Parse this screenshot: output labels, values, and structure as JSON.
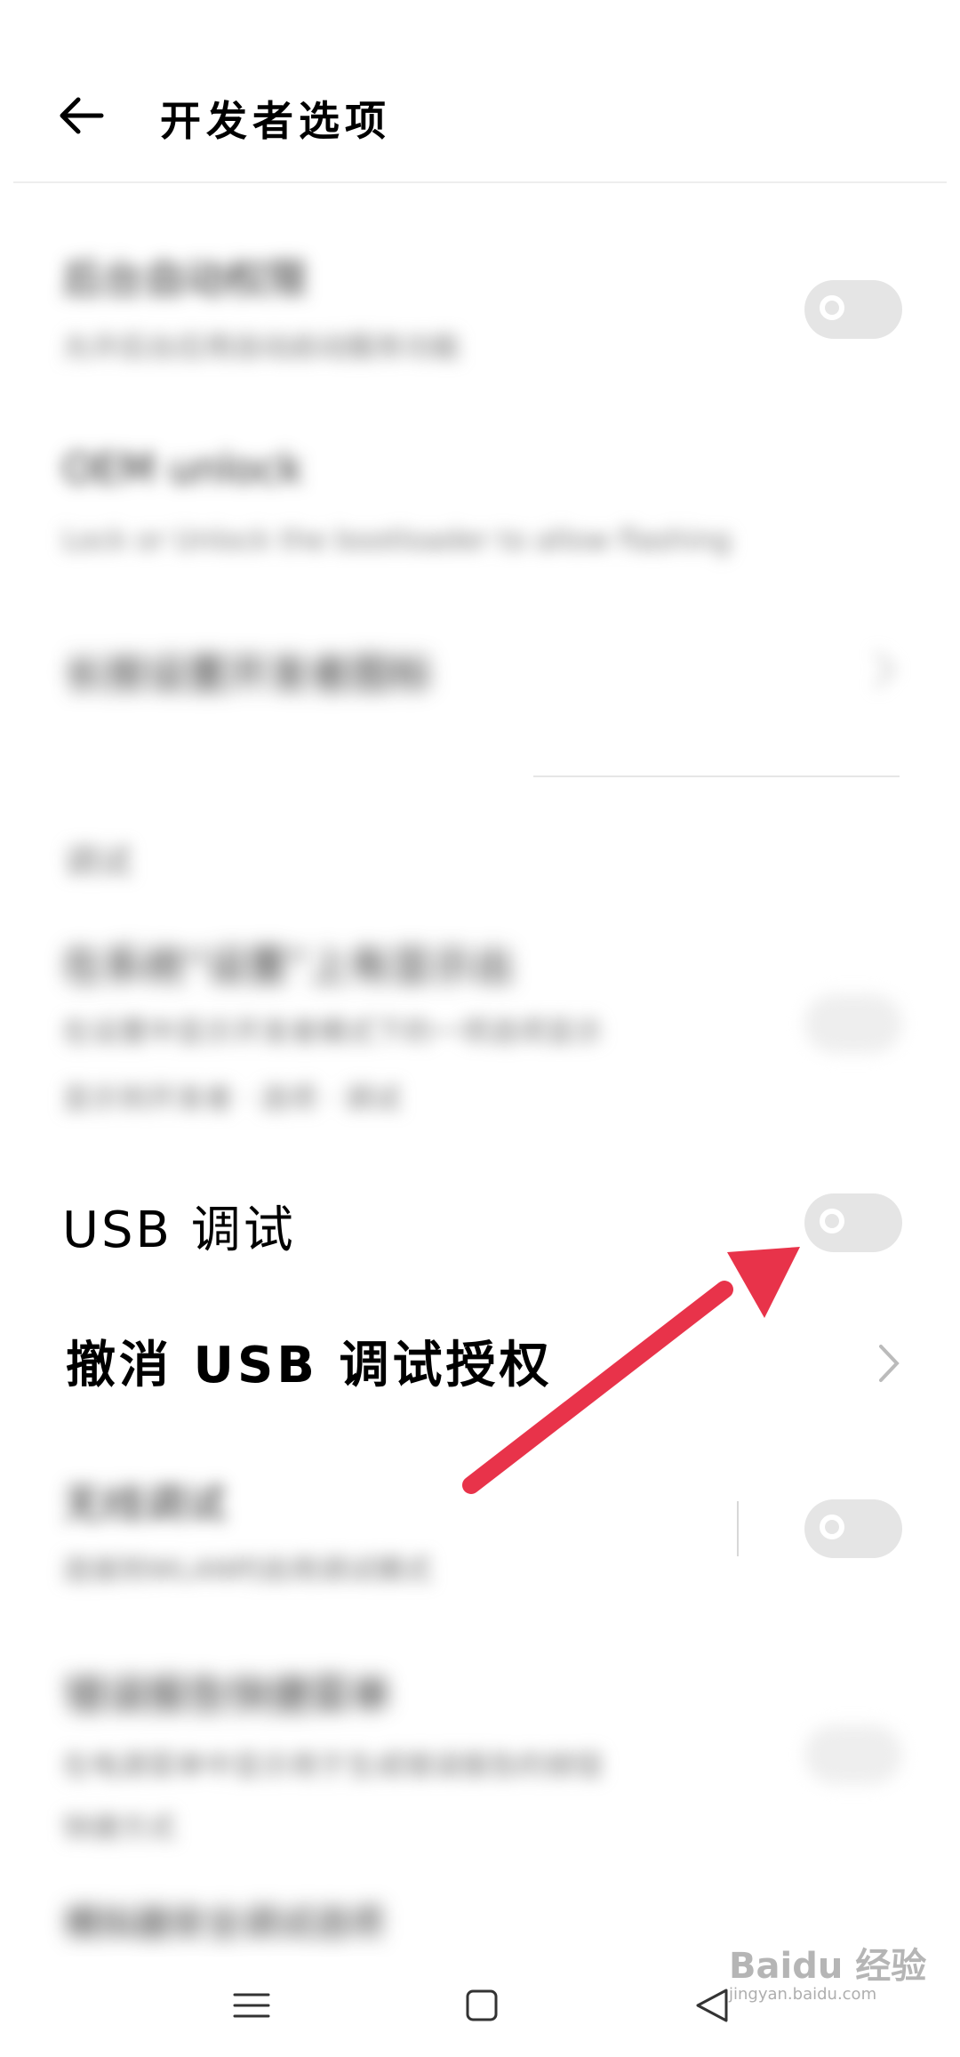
{
  "header": {
    "title": "开发者选项",
    "back_icon": "arrow-left-icon"
  },
  "items": {
    "blur1": {
      "title": "后台自动权限",
      "subtitle": "允许后台应用自动启动服务功能"
    },
    "blur2": {
      "title": "OEM unlock",
      "subtitle": "Lock or Unlock the bootloader to allow flashing"
    },
    "blur3": {
      "title": "长按设置开发者图标",
      "subtitle": ""
    },
    "section": "调试",
    "blur4": {
      "title": "在系统“设置”上有显示出",
      "subtitle": "在设置中显示开发者模式下的一项选项显示",
      "subtitle2": "显示到开发者 · 选项 · 调试"
    },
    "usb_debug": {
      "title": "USB 调试",
      "toggle": "off"
    },
    "revoke": {
      "title": "撤消 USB 调试授权"
    },
    "blur5": {
      "title": "无线调试",
      "subtitle": "连接到WLAN时启用调试模式"
    },
    "blur6": {
      "title": "错误报告快捷菜单",
      "subtitle": "在电源菜单中显示用于生成错误报告的按钮",
      "subtitle2": "快捷方式"
    },
    "blur7": {
      "title": "模拟器安全调试选项"
    }
  },
  "navbar": {
    "menu_icon": "menu-lines-icon",
    "home_icon": "home-square-icon",
    "back_icon": "back-triangle-icon"
  },
  "watermark": {
    "text": "Baidu 经验",
    "url_text": "jingyan.baidu.com"
  },
  "colors": {
    "arrow": "#e8334a",
    "toggle_off": "#e5e5e5"
  }
}
